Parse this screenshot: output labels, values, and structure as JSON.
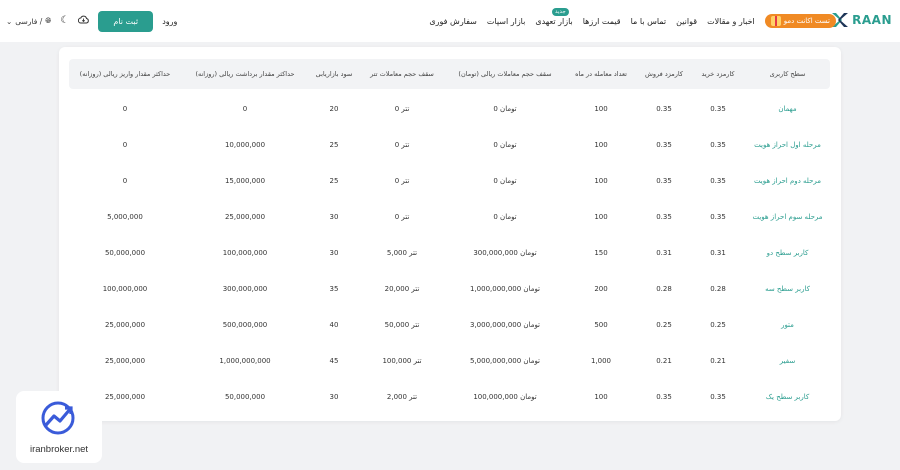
{
  "brand": {
    "logo_letters": "RAAN",
    "accent": "#2a9d8f"
  },
  "nav": {
    "items": [
      {
        "label": "سفارش فوری"
      },
      {
        "label": "بازار اسپات"
      },
      {
        "label": "بازار تعهدی",
        "badge": "جدید"
      },
      {
        "label": "قیمت ارزها"
      },
      {
        "label": "تماس با ما"
      },
      {
        "label": "قوانین"
      },
      {
        "label": "اخبار و مقالات"
      }
    ],
    "demo_label": "تست اکانت دمو"
  },
  "controls": {
    "login_label": "ورود",
    "signup_label": "ثبت نام",
    "language_label": "فارسی /",
    "globe_icon": "globe-icon",
    "theme_icon": "moon-icon",
    "download_icon": "cloud-download-icon"
  },
  "table": {
    "headers": [
      "سطح کاربری",
      "کارمزد خرید",
      "کارمزد فروش",
      "تعداد معامله در ماه",
      "سقف حجم معاملات ریالی (تومان)",
      "سقف حجم معاملات تتر",
      "سود بازاریابی",
      "حداکثر مقدار برداشت ریالی (روزانه)",
      "حداکثر مقدار واریز ریالی (روزانه)"
    ],
    "rows": [
      [
        "مهمان",
        "0.35",
        "0.35",
        "100",
        "0 تومان",
        "0 تتر",
        "20",
        "0",
        "0"
      ],
      [
        "مرحله اول احراز هویت",
        "0.35",
        "0.35",
        "100",
        "0 تومان",
        "0 تتر",
        "25",
        "10,000,000",
        "0"
      ],
      [
        "مرحله دوم احراز هویت",
        "0.35",
        "0.35",
        "100",
        "0 تومان",
        "0 تتر",
        "25",
        "15,000,000",
        "0"
      ],
      [
        "مرحله سوم احراز هویت",
        "0.35",
        "0.35",
        "100",
        "0 تومان",
        "0 تتر",
        "30",
        "25,000,000",
        "5,000,000"
      ],
      [
        "کاربر سطح دو",
        "0.31",
        "0.31",
        "150",
        "300,000,000 تومان",
        "5,000 تتر",
        "30",
        "100,000,000",
        "50,000,000"
      ],
      [
        "کاربر سطح سه",
        "0.28",
        "0.28",
        "200",
        "1,000,000,000 تومان",
        "20,000 تتر",
        "35",
        "300,000,000",
        "100,000,000"
      ],
      [
        "متور",
        "0.25",
        "0.25",
        "500",
        "3,000,000,000 تومان",
        "50,000 تتر",
        "40",
        "500,000,000",
        "25,000,000"
      ],
      [
        "سفیر",
        "0.21",
        "0.21",
        "1,000",
        "5,000,000,000 تومان",
        "100,000 تتر",
        "45",
        "1,000,000,000",
        "25,000,000"
      ],
      [
        "کاربر سطح یک",
        "0.35",
        "0.35",
        "100",
        "100,000,000 تومان",
        "2,000 تتر",
        "30",
        "50,000,000",
        "25,000,000"
      ]
    ]
  },
  "watermark": {
    "text": "iranbroker.net"
  }
}
